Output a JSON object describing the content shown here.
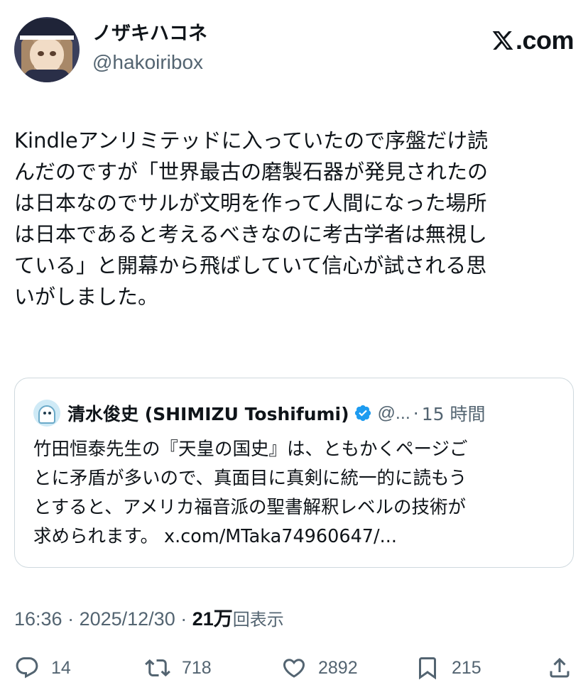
{
  "author": {
    "display_name": "ノザキハコネ",
    "handle": "@hakoiribox"
  },
  "brand": {
    "label": ".com",
    "icon": "x-logo-icon"
  },
  "tweet": {
    "lines": [
      "Kindleアンリミテッドに入っていたので序盤だけ読",
      "んだのですが「世界最古の磨製石器が発見されたの",
      "は日本なのでサルが文明を作って人間になった場所",
      "は日本であると考えるべきなのに考古学者は無視し",
      "ている」と開幕から飛ばしていて信心が試される思",
      "いがしました。"
    ]
  },
  "quote": {
    "author_name": "清水俊史 (SHIMIZU Toshifumi)",
    "handle": "@...",
    "separator": "·",
    "time": "15 時間",
    "verified_icon": "verified-badge-icon",
    "lines": [
      "竹田恒泰先生の『天皇の国史』は、ともかくページご",
      "とに矛盾が多いので、真面目に真剣に統一的に読もう",
      "とすると、アメリカ福音派の聖書解釈レベルの技術が",
      "求められます。 x.com/MTaka74960647/..."
    ]
  },
  "meta": {
    "time": "16:36",
    "sep1": " · ",
    "date": "2025/12/30",
    "sep2": " · ",
    "views_num": "21万",
    "views_label": "回表示"
  },
  "actions": {
    "replies": "14",
    "reposts": "718",
    "likes": "2892",
    "bookmarks": "215"
  },
  "colors": {
    "text": "#0f1419",
    "secondary": "#536471",
    "border": "#cfd9de",
    "verified": "#1d9bf0"
  }
}
